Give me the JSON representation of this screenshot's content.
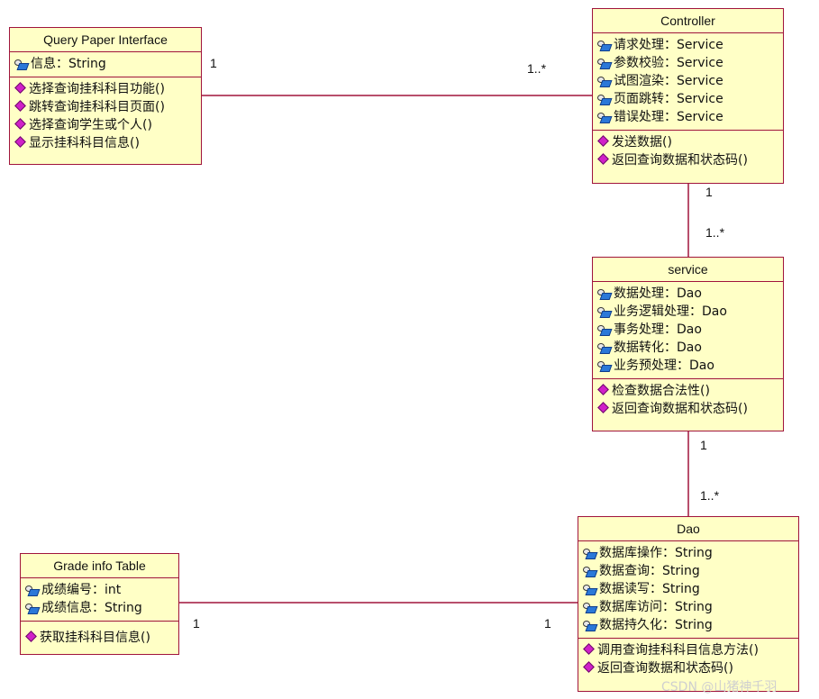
{
  "classes": {
    "query": {
      "title": "Query Paper Interface",
      "attributes": [
        {
          "text": "信息：String"
        }
      ],
      "operations": [
        {
          "text": "选择查询挂科科目功能()"
        },
        {
          "text": "跳转查询挂科科目页面()"
        },
        {
          "text": "选择查询学生或个人()"
        },
        {
          "text": "显示挂科科目信息()"
        }
      ]
    },
    "controller": {
      "title": "Controller",
      "attributes": [
        {
          "text": "请求处理：Service"
        },
        {
          "text": "参数校验：Service"
        },
        {
          "text": "试图渲染：Service"
        },
        {
          "text": "页面跳转：Service"
        },
        {
          "text": "错误处理：Service"
        }
      ],
      "operations": [
        {
          "text": "发送数据()"
        },
        {
          "text": "返回查询数据和状态码()"
        }
      ]
    },
    "service": {
      "title": "service",
      "attributes": [
        {
          "text": "数据处理：Dao"
        },
        {
          "text": "业务逻辑处理：Dao"
        },
        {
          "text": "事务处理：Dao"
        },
        {
          "text": "数据转化：Dao"
        },
        {
          "text": "业务预处理：Dao"
        }
      ],
      "operations": [
        {
          "text": "检查数据合法性()"
        },
        {
          "text": "返回查询数据和状态码()"
        }
      ]
    },
    "dao": {
      "title": "Dao",
      "attributes": [
        {
          "text": "数据库操作：String"
        },
        {
          "text": "数据查询：String"
        },
        {
          "text": "数据读写：String"
        },
        {
          "text": "数据库访问：String"
        },
        {
          "text": "数据持久化：String"
        }
      ],
      "operations": [
        {
          "text": "调用查询挂科科目信息方法()"
        },
        {
          "text": "返回查询数据和状态码()"
        }
      ]
    },
    "grade": {
      "title": "Grade info Table",
      "attributes": [
        {
          "text": "成绩编号：int"
        },
        {
          "text": "成绩信息：String"
        }
      ],
      "operations": [
        {
          "text": "获取挂科科目信息()"
        }
      ]
    }
  },
  "multiplicities": {
    "query_controller_left": "1",
    "query_controller_right": "1..*",
    "controller_service_top": "1",
    "controller_service_bottom": "1..*",
    "service_dao_top": "1",
    "service_dao_bottom": "1..*",
    "grade_dao_left": "1",
    "grade_dao_right": "1"
  },
  "watermark": "CSDN @山猪神千羽",
  "colors": {
    "class_fill": "#ffffc6",
    "class_border": "#a0143c",
    "association_line": "#a0143c",
    "operation_icon": "#d020c8",
    "attribute_icon": "#2a78d8"
  },
  "icons": {
    "attribute": "key-attribute-icon",
    "operation": "diamond-operation-icon"
  }
}
